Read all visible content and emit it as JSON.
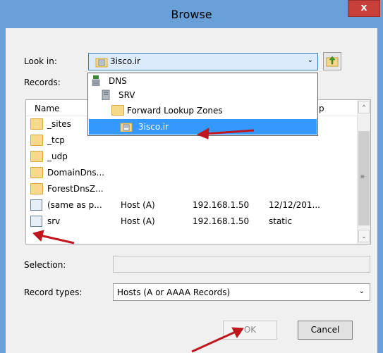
{
  "window": {
    "title": "Browse",
    "close_glyph": "x"
  },
  "look_in": {
    "label": "Look in:",
    "value": "3isco.ir",
    "arrow": "⌄"
  },
  "records_label": "Records:",
  "dropdown_items": [
    {
      "label": "DNS",
      "icon": "dns-server-icon"
    },
    {
      "label": "SRV",
      "icon": "server-icon"
    },
    {
      "label": "Forward Lookup Zones",
      "icon": "folder-icon"
    },
    {
      "label": "3isco.ir",
      "icon": "zone-icon",
      "selected": true
    }
  ],
  "columns": [
    "Name",
    "p"
  ],
  "records": [
    {
      "name": "_sites",
      "type": "",
      "data": "",
      "timestamp": "",
      "icon": "folder-icon"
    },
    {
      "name": "_tcp",
      "type": "",
      "data": "",
      "timestamp": "",
      "icon": "folder-icon"
    },
    {
      "name": "_udp",
      "type": "",
      "data": "",
      "timestamp": "",
      "icon": "folder-icon"
    },
    {
      "name": "DomainDns...",
      "type": "",
      "data": "",
      "timestamp": "",
      "icon": "folder-icon"
    },
    {
      "name": "ForestDnsZ...",
      "type": "",
      "data": "",
      "timestamp": "",
      "icon": "folder-icon"
    },
    {
      "name": "(same as p...",
      "type": "Host (A)",
      "data": "192.168.1.50",
      "timestamp": "12/12/201...",
      "icon": "record-icon"
    },
    {
      "name": "srv",
      "type": "Host (A)",
      "data": "192.168.1.50",
      "timestamp": "static",
      "icon": "record-icon"
    }
  ],
  "selection": {
    "label": "Selection:",
    "value": ""
  },
  "record_types": {
    "label": "Record types:",
    "value": "Hosts (A or AAAA Records)",
    "arrow": "⌄"
  },
  "buttons": {
    "ok": "OK",
    "cancel": "Cancel"
  },
  "scroll": {
    "up": "^",
    "down": "⌄",
    "grip": "≡"
  },
  "annotation_color": "#c0171f"
}
